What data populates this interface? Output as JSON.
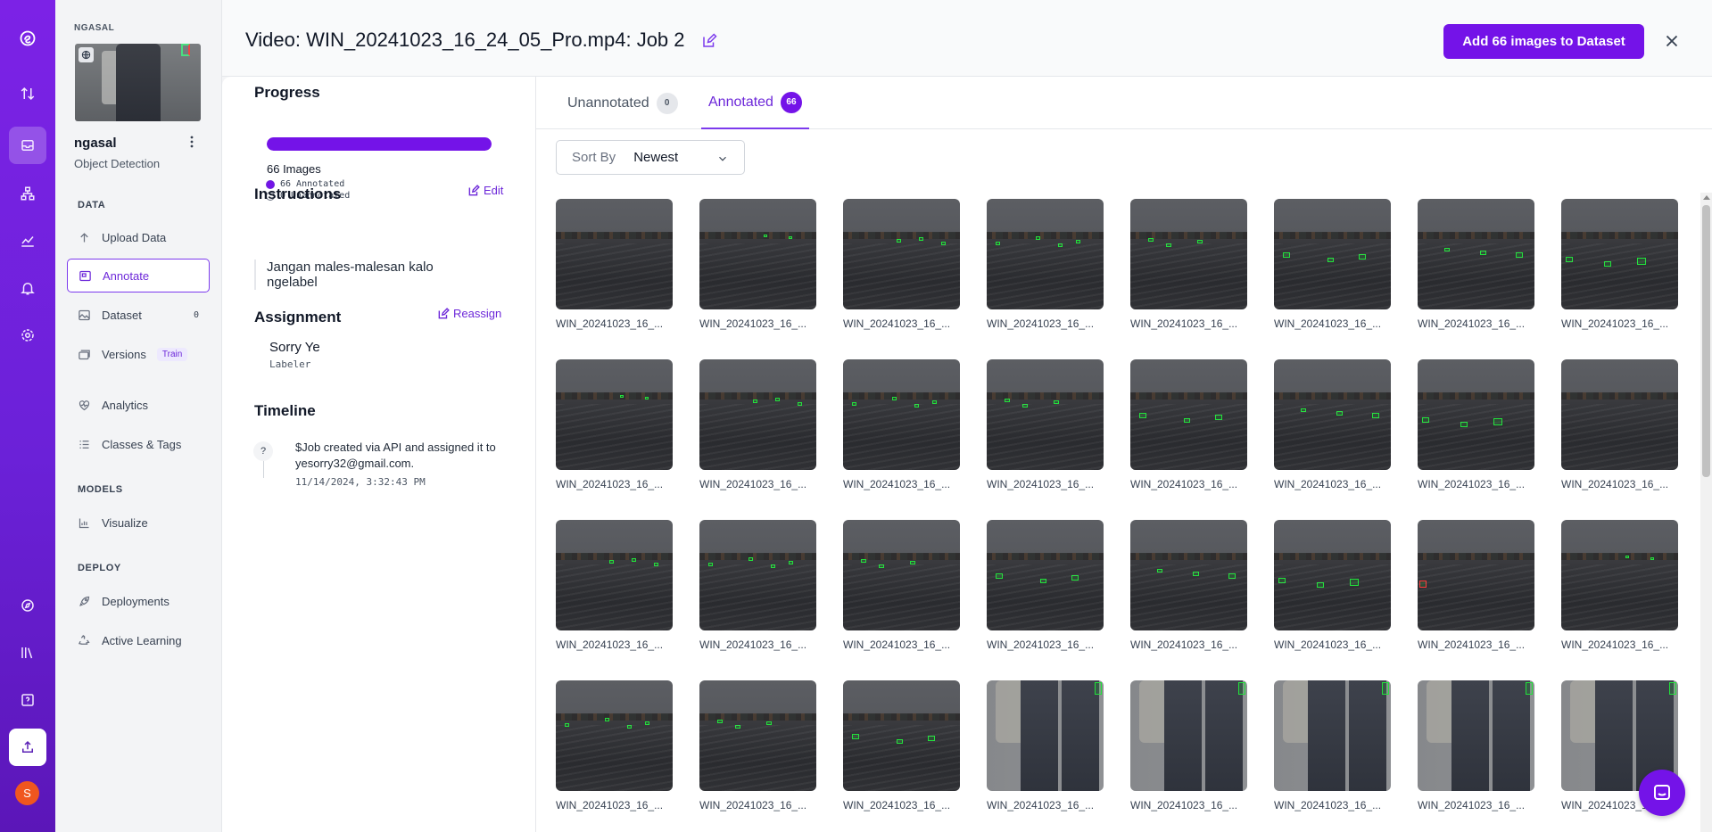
{
  "workspace": {
    "label": "NGASAL"
  },
  "project": {
    "name": "ngasal",
    "type": "Object Detection"
  },
  "nav": {
    "sections": {
      "data": "DATA",
      "models": "MODELS",
      "deploy": "DEPLOY"
    },
    "items": [
      {
        "label": "Upload Data",
        "icon": "upload-arrow-icon"
      },
      {
        "label": "Annotate",
        "icon": "annotate-icon",
        "active": true
      },
      {
        "label": "Dataset",
        "icon": "image-icon",
        "badge": "0"
      },
      {
        "label": "Versions",
        "icon": "stack-icon",
        "pill": "Train"
      },
      {
        "label": "Analytics",
        "icon": "heartbeat-icon"
      },
      {
        "label": "Classes & Tags",
        "icon": "list-icon"
      },
      {
        "label": "Visualize",
        "icon": "chart-icon"
      },
      {
        "label": "Deployments",
        "icon": "rocket-icon"
      },
      {
        "label": "Active Learning",
        "icon": "recycle-icon"
      }
    ]
  },
  "rail": {
    "avatar_initial": "S",
    "accent": "#7413e8"
  },
  "header": {
    "title": "Video: WIN_20241023_16_24_05_Pro.mp4: Job 2",
    "add_button": "Add 66 images to Dataset"
  },
  "job": {
    "progress_title": "Progress",
    "progress_fraction": 1.0,
    "images_count": "66 Images",
    "annotated_count": "66 Annotated",
    "unannotated_count": "0 Unannotated",
    "instructions_title": "Instructions",
    "edit_label": "Edit",
    "instructions_text": "Jangan males-malesan kalo ngelabel",
    "assignment_title": "Assignment",
    "reassign_label": "Reassign",
    "assignee_name": "Sorry Ye",
    "assignee_role": "Labeler",
    "timeline_title": "Timeline",
    "timeline_icon": "?",
    "timeline_text": "$Job created via API and assigned it to yesorry32@gmail.com.",
    "timeline_time": "11/14/2024, 3:32:43 PM"
  },
  "tabs": [
    {
      "label": "Unannotated",
      "count": "0"
    },
    {
      "label": "Annotated",
      "count": "66",
      "active": true
    }
  ],
  "sort": {
    "label": "Sort By",
    "value": "Newest"
  },
  "thumbnails": {
    "caption": "WIN_20241023_16_...",
    "rows": [
      [
        "water",
        "water",
        "water",
        "water",
        "water",
        "water",
        "water",
        "water"
      ],
      [
        "water",
        "water",
        "water",
        "water",
        "water",
        "water",
        "water",
        "water"
      ],
      [
        "water",
        "water",
        "water",
        "water",
        "water",
        "water",
        "water",
        "water"
      ],
      [
        "water",
        "water",
        "water",
        "person",
        "person",
        "person",
        "person",
        "person"
      ]
    ]
  }
}
